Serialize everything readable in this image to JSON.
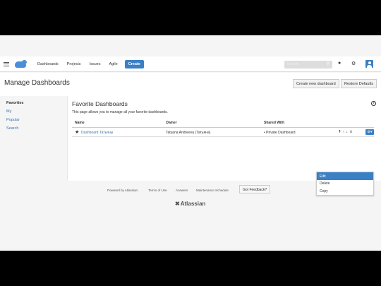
{
  "nav": {
    "items": [
      "Dashboards",
      "Projects",
      "Issues",
      "Agile"
    ],
    "create_label": "Create",
    "search_placeholder": "Search"
  },
  "header": {
    "title": "Manage Dashboards",
    "create_new_label": "Create new dashboard",
    "restore_label": "Restore Defaults"
  },
  "sidebar": {
    "title": "Favorites",
    "links": [
      "My",
      "Popular",
      "Search"
    ]
  },
  "main": {
    "title": "Favorite Dashboards",
    "description": "This page allows you to manage all your favorite dashboards.",
    "columns": [
      "Name",
      "Owner",
      "Shared With"
    ],
    "rows": [
      {
        "name": "Dashboard Татьяны",
        "owner": "Tatyana Andreeva (Татьяна)",
        "shared": "Private Dashboard"
      }
    ]
  },
  "menu": {
    "items": [
      "Edit",
      "Delete",
      "Copy"
    ],
    "active": "Edit"
  },
  "footer": {
    "links": [
      "Powered by Atlassian",
      "Terms of Use",
      "Answers",
      "Maintenance Schedule"
    ],
    "feedback_label": "Got Feedback?",
    "brand": "Atlassian"
  },
  "colors": {
    "accent": "#3b7fc4",
    "link": "#3b73af"
  }
}
